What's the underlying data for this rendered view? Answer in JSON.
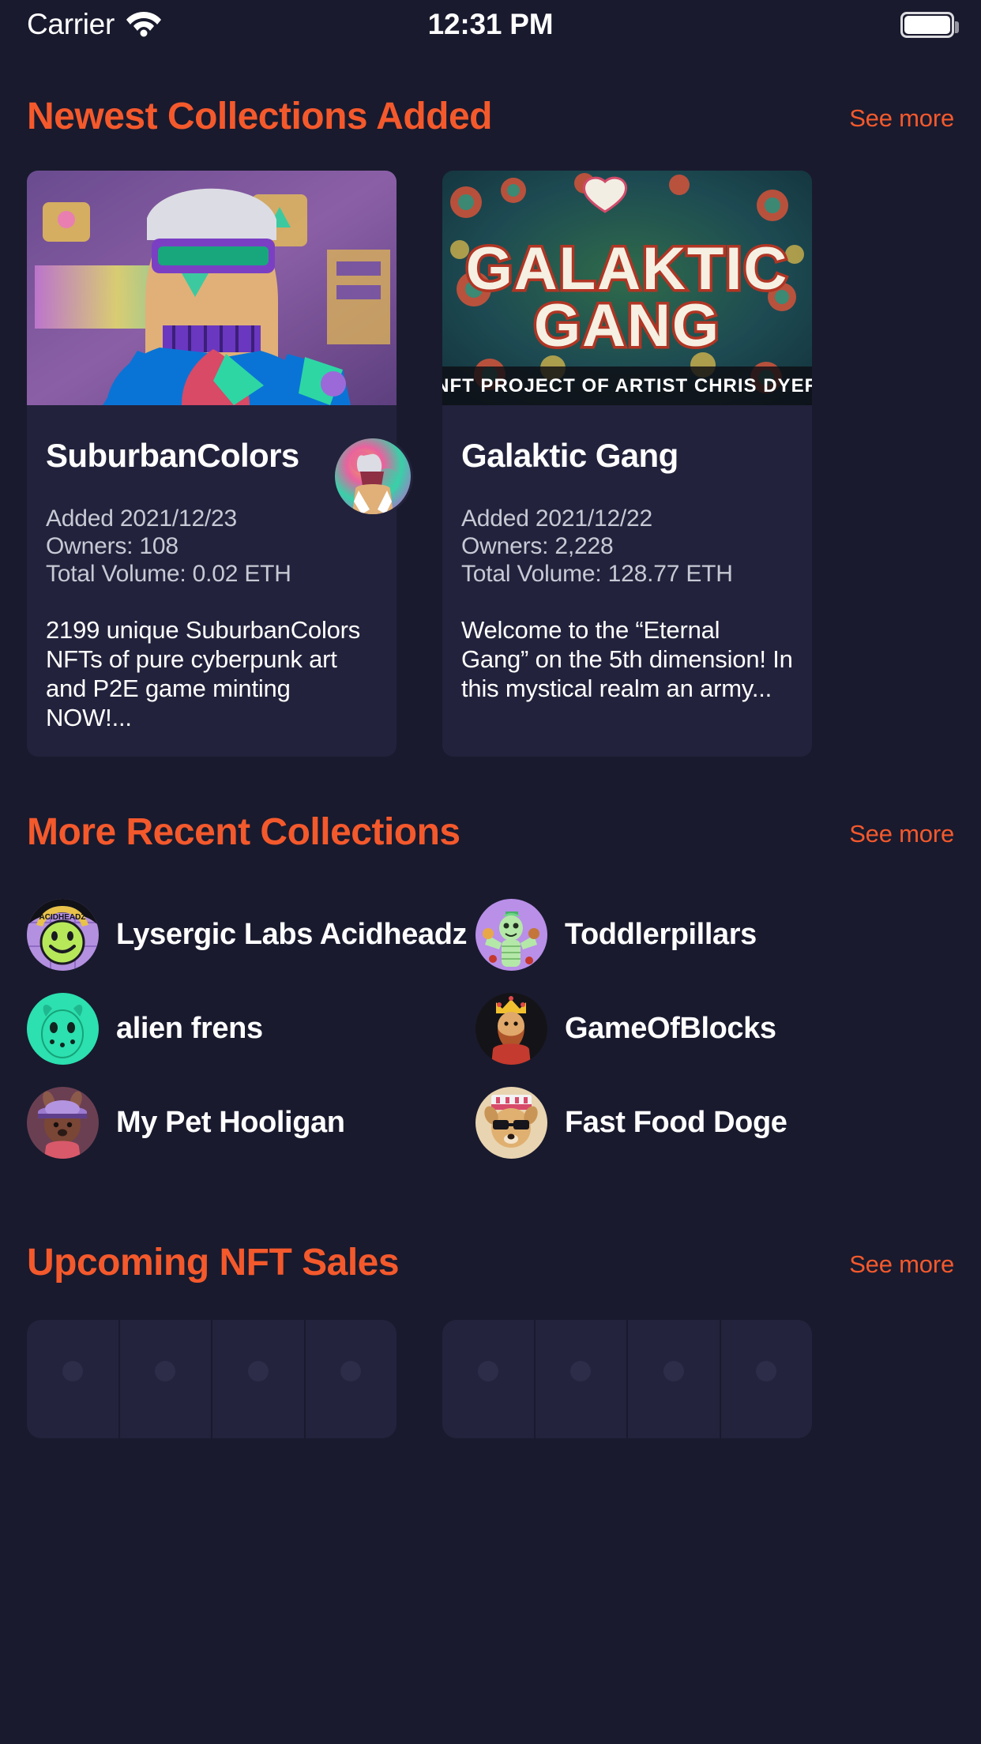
{
  "theme": {
    "background": "#191a2e",
    "card": "#22223c",
    "accent": "#f4592c",
    "text_primary": "#ffffff",
    "text_secondary": "#c7c9d4"
  },
  "statusbar": {
    "carrier": "Carrier",
    "wifi_icon": "wifi-icon",
    "time": "12:31 PM",
    "battery_icon": "battery-full-icon"
  },
  "sections": {
    "newest": {
      "title": "Newest Collections Added",
      "see_more": "See more"
    },
    "recent": {
      "title": "More Recent Collections",
      "see_more": "See more"
    },
    "upcoming": {
      "title": "Upcoming NFT Sales",
      "see_more": "See more"
    }
  },
  "newest_collections": [
    {
      "name": "SuburbanColors",
      "added_label": "Added 2021/12/23",
      "owners_label": "Owners: 108",
      "volume_label": "Total Volume: 0.02 ETH",
      "description": "2199 unique SuburbanColors NFTs of pure cyberpunk art and P2E game minting NOW!..."
    },
    {
      "name": "Galaktic Gang",
      "added_label": "Added 2021/12/22",
      "owners_label": "Owners: 2,228",
      "volume_label": "Total Volume: 128.77 ETH",
      "description": "Welcome to the “Eternal Gang” on the 5th dimension! In this mystical realm an army..."
    }
  ],
  "recent_collections": [
    {
      "label": "Lysergic Labs Acidheadz",
      "avatar": "acidheadz-avatar"
    },
    {
      "label": "Toddlerpillars",
      "avatar": "toddlerpillars-avatar"
    },
    {
      "label": "alien frens",
      "avatar": "alien-frens-avatar"
    },
    {
      "label": "GameOfBlocks",
      "avatar": "gameofblocks-avatar"
    },
    {
      "label": "My Pet Hooligan",
      "avatar": "my-pet-hooligan-avatar"
    },
    {
      "label": "Fast Food Doge",
      "avatar": "fast-food-doge-avatar"
    }
  ],
  "upcoming_sales": [
    {
      "cells": 4
    },
    {
      "cells": 4
    }
  ]
}
